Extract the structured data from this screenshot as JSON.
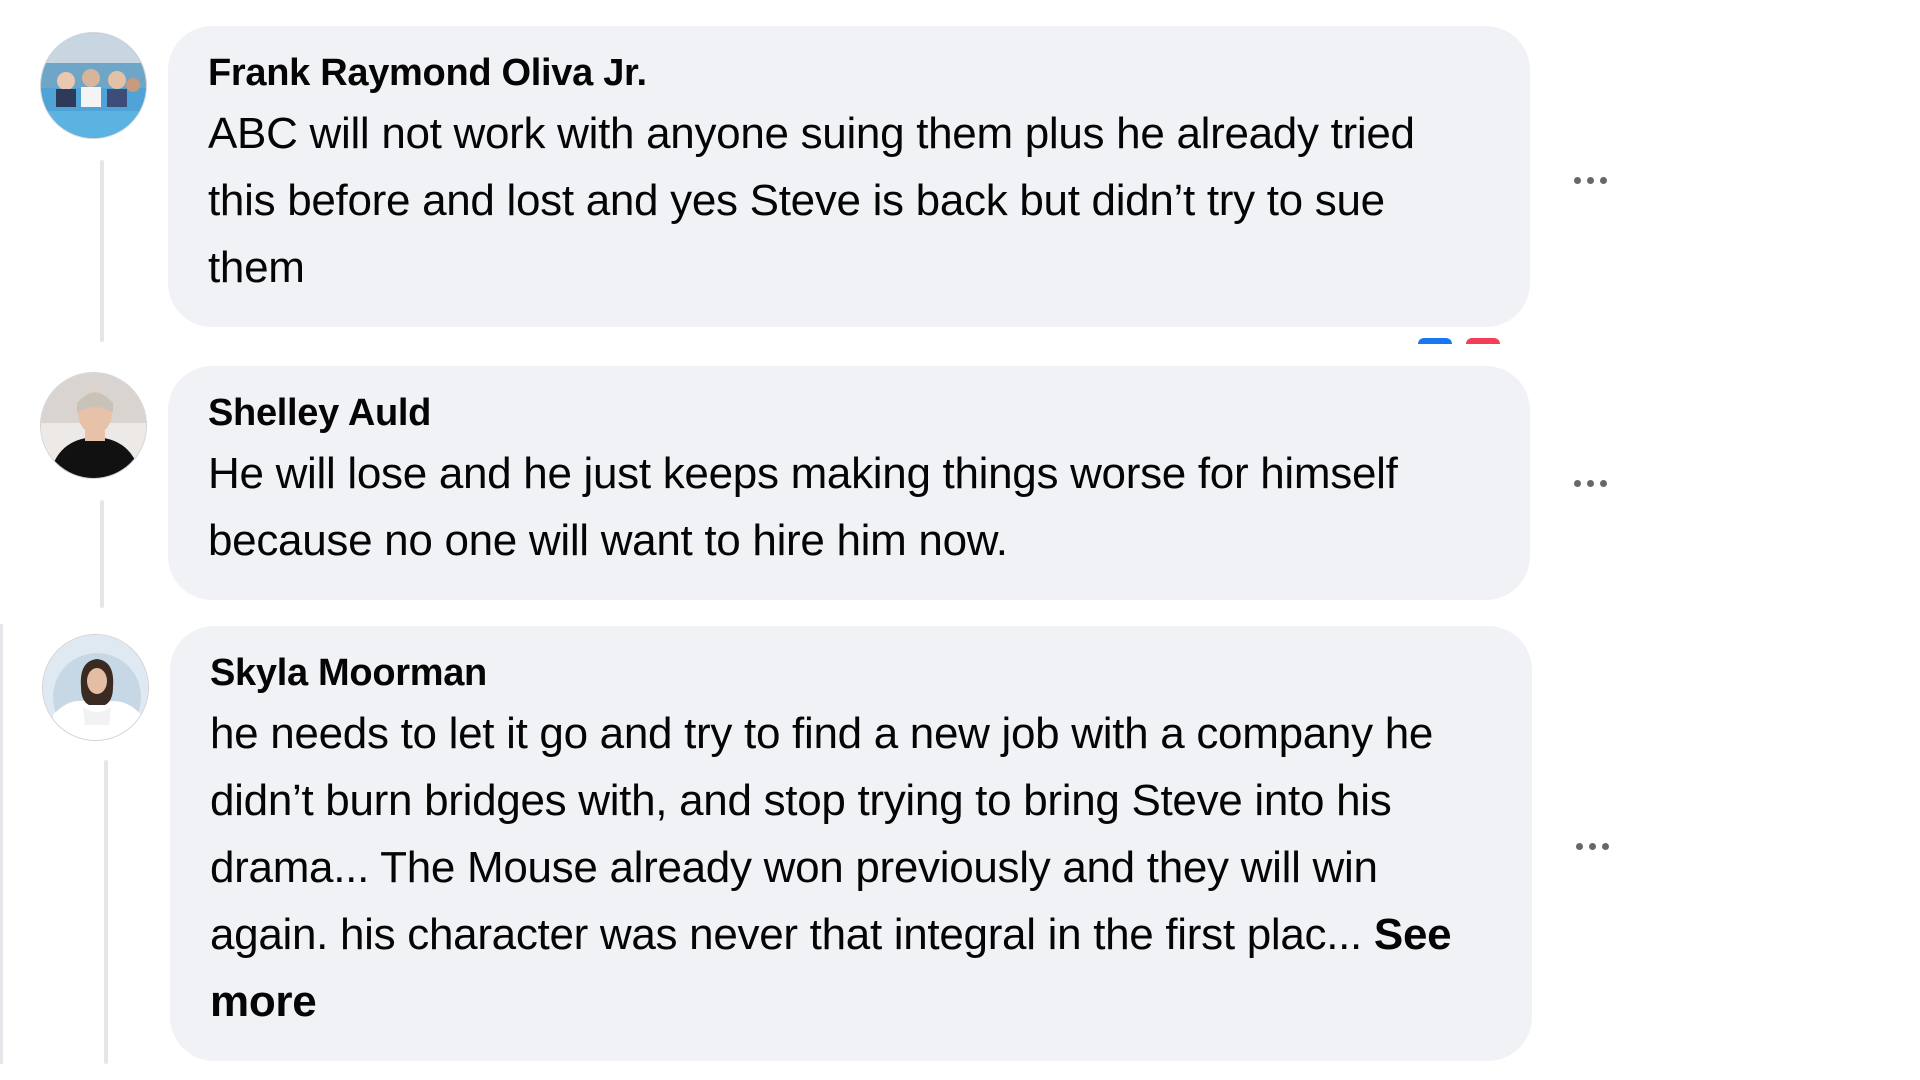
{
  "comments": [
    {
      "author": "Frank Raymond Oliva Jr.",
      "text": "ABC will not work with anyone suing them plus he already tried this before and lost and yes Steve is back but didn’t try to sue them",
      "more_icon": "more-horizontal-icon"
    },
    {
      "author": "Shelley Auld",
      "text": "He will lose and he just keeps making things worse for himself because no one will want to hire him now.",
      "more_icon": "more-horizontal-icon"
    },
    {
      "author": "Skyla Moorman",
      "text": "he needs to let it go and try to find a new job with a company he didn’t burn bridges with, and stop trying to bring Steve into his drama... The Mouse already won previously and they will win again. his character was never that integral in the first plac...",
      "see_more": "See more",
      "more_icon": "more-horizontal-icon"
    }
  ],
  "colors": {
    "bubble": "#f0f2f5",
    "text": "#050505",
    "icon": "#65676b",
    "thread_line": "#e4e6ea",
    "like_blue": "#1877f2",
    "love_red": "#f33e58"
  }
}
